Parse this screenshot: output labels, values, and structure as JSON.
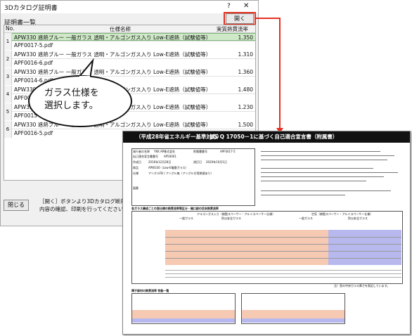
{
  "window": {
    "title": "3Dカタログ証明書",
    "help": "?",
    "close": "✕"
  },
  "list_title": "証明書一覧",
  "open_button": "開く",
  "close_button": "閉じる",
  "columns": {
    "no": "No.",
    "spec": "仕様名称",
    "value": "実質熱貫流率"
  },
  "rows": [
    {
      "no": "1",
      "spec": "APW330 遮熱ブルー 一般ガラス 透明・アルゴンガス入り Low-E遮熱（試験値等）",
      "value": "1.350",
      "pdf": "APF0017-5.pdf",
      "selected": true
    },
    {
      "no": "2",
      "spec": "APW330 遮熱ブルー 一般ガラス 透明・アルゴンガス入り Low-E遮熱（試験値等）",
      "value": "1.310",
      "pdf": "APF0016-6.pdf",
      "selected": false
    },
    {
      "no": "3",
      "spec": "APW330 遮熱ブルー 一般ガラス 透明・アルゴンガス入り Low-E遮熱（試験値等）",
      "value": "1.360",
      "pdf": "APF0014-6.pdf",
      "selected": false
    },
    {
      "no": "4",
      "spec": "APW330 遮熱ブルー 一般ガラス 透明・アルゴンガス入り Low-E遮熱（試験値等）",
      "value": "1.480",
      "pdf": "APF0014-8.pdf",
      "selected": false
    },
    {
      "no": "5",
      "spec": "APW330 遮熱ブルー 一般ガラス 透明・アルゴンガス入り Low-E遮熱（試験値等）",
      "value": "1.230",
      "pdf": "APF0015-8.pdf",
      "selected": false
    },
    {
      "no": "6",
      "spec": "APW330 遮熱ブルー 一般ガラス 透明・アルゴンガス入り Low-E遮熱（試験値等）",
      "value": "1.500",
      "pdf": "APF0016-5.pdf",
      "selected": false
    }
  ],
  "note_lines": [
    "［開く］ボタンより3Dカタログ断熱性能の証明書",
    "内容の確認、印刷を行ってください。"
  ],
  "callout_lines": [
    "ガラス仕様を",
    "選択します。"
  ],
  "document": {
    "header_left": "（平成28年省エネルギー基準対応）",
    "header_right": "JIS Q 17050－1に基づく自己適合宣言書（附属書）",
    "fields": {
      "issuer_label": "発行者の名称",
      "issuer": "YKK AP株式会社",
      "doc_no_label": "自己適合宣言書番号",
      "doc_no": "AP50001",
      "annex_label": "附属書番号",
      "annex": "APF0017-5",
      "date_label": "作成日",
      "date": "2016年12月28日",
      "revised_label": "改訂日",
      "revised": "2020年10月1日",
      "product_label": "商品",
      "product": "APW330（Low-E複層ガラス）",
      "spec_label": "仕様",
      "spec": "アングルFB / アングル無（アングル付用熱値あり）",
      "remarks_label": "図番"
    },
    "section1": "各ガラス構成ごとの窓仕様の熱貫流率等区分・開口部の目安熱貫流率",
    "section2": "障子部材の熱貫流率 性能一覧",
    "sub_argon": "アルゴンガス入り（樹脂スペーサー・アルミスペーサー仕様）",
    "sub_air": "空気（樹脂スペーサー・アルミスペーサー仕様）",
    "glass_general": "一般ガラス",
    "glass_security": "防災安全ガラス",
    "footnote": "注）窓の中央ガラス厚さを表記しています。"
  }
}
